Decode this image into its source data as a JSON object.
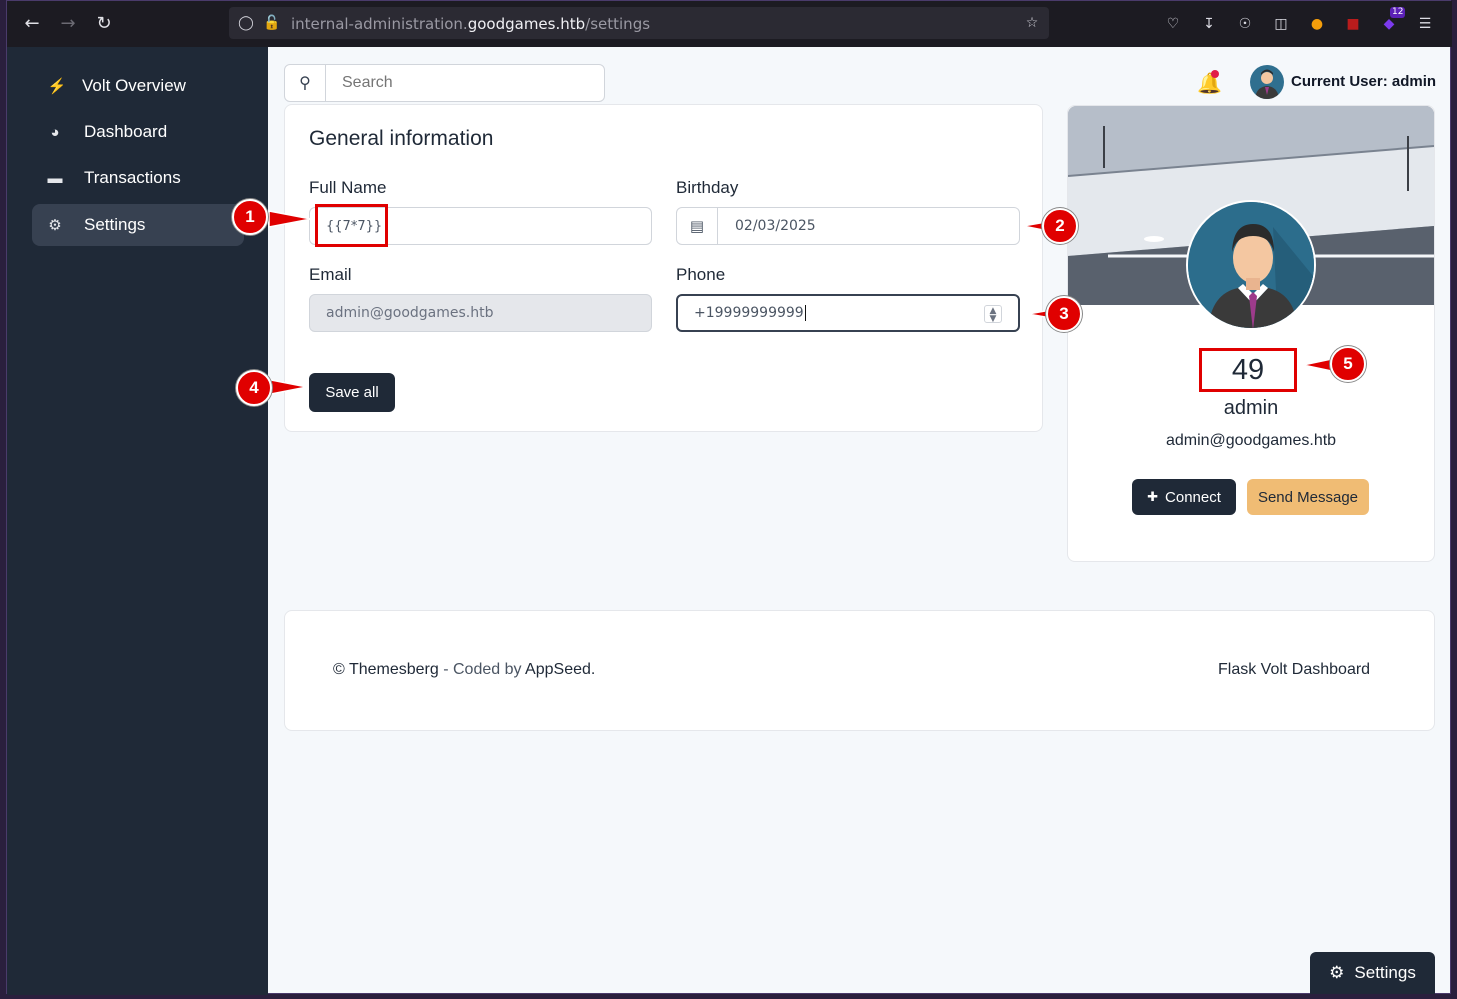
{
  "browser": {
    "url_prefix": "internal-administration.",
    "url_host": "goodgames.htb",
    "url_path": "/settings",
    "ext_badge_count": "12"
  },
  "sidebar": {
    "items": [
      {
        "label": "Volt Overview",
        "icon": "bolt-icon"
      },
      {
        "label": "Dashboard",
        "icon": "pie-chart-icon"
      },
      {
        "label": "Transactions",
        "icon": "credit-card-icon"
      },
      {
        "label": "Settings",
        "icon": "gear-icon",
        "active": true
      }
    ]
  },
  "topbar": {
    "search_placeholder": "Search",
    "current_user_label": "Current User: admin"
  },
  "general_info": {
    "title": "General information",
    "full_name_label": "Full Name",
    "full_name_value": "{{7*7}}",
    "birthday_label": "Birthday",
    "birthday_value": "02/03/2025",
    "email_label": "Email",
    "email_value": "admin@goodgames.htb",
    "phone_label": "Phone",
    "phone_value": "+19999999999",
    "save_label": "Save all"
  },
  "profile": {
    "rendered_name_value": "49",
    "username": "admin",
    "email": "admin@goodgames.htb",
    "connect_label": "Connect",
    "message_label": "Send Message"
  },
  "footer": {
    "copyright_prefix": "© Themesberg",
    "coded_by": " - Coded by ",
    "appseed": "AppSeed",
    "period": ".",
    "right_text": "Flask Volt Dashboard"
  },
  "floating_settings_label": "Settings",
  "annotations": [
    "1",
    "2",
    "3",
    "4",
    "5"
  ],
  "colors": {
    "sidebar_bg": "#1f2937",
    "accent_dark": "#1f2937",
    "accent_amber": "#f0bc74",
    "annotation_red": "#e00000"
  }
}
